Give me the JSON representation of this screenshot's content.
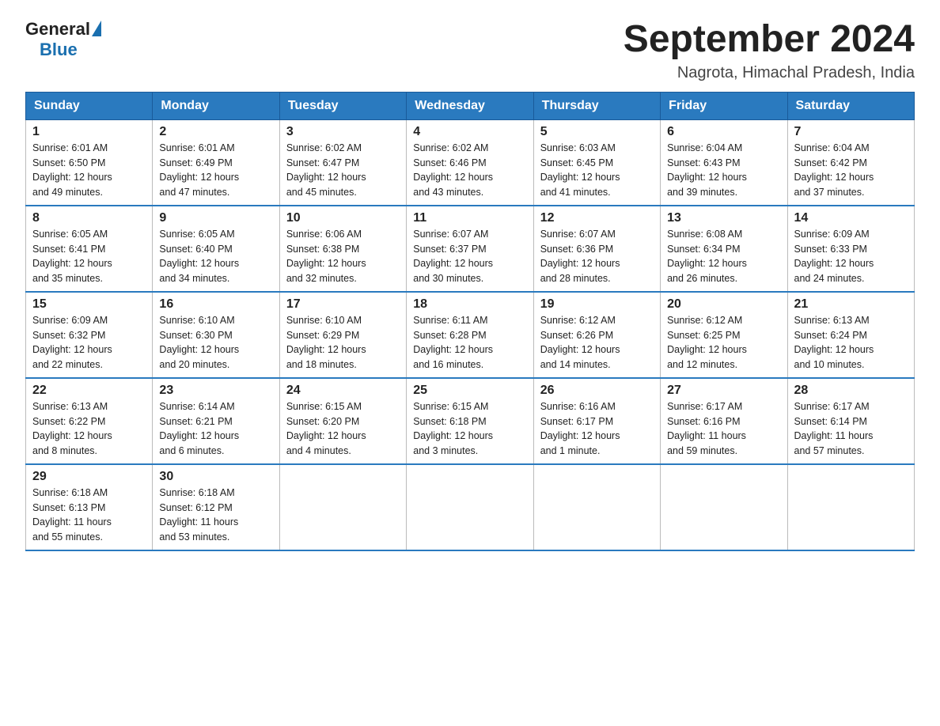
{
  "logo": {
    "general": "General",
    "blue": "Blue"
  },
  "title": "September 2024",
  "subtitle": "Nagrota, Himachal Pradesh, India",
  "days_of_week": [
    "Sunday",
    "Monday",
    "Tuesday",
    "Wednesday",
    "Thursday",
    "Friday",
    "Saturday"
  ],
  "weeks": [
    [
      {
        "day": "1",
        "sunrise": "6:01 AM",
        "sunset": "6:50 PM",
        "daylight": "12 hours and 49 minutes."
      },
      {
        "day": "2",
        "sunrise": "6:01 AM",
        "sunset": "6:49 PM",
        "daylight": "12 hours and 47 minutes."
      },
      {
        "day": "3",
        "sunrise": "6:02 AM",
        "sunset": "6:47 PM",
        "daylight": "12 hours and 45 minutes."
      },
      {
        "day": "4",
        "sunrise": "6:02 AM",
        "sunset": "6:46 PM",
        "daylight": "12 hours and 43 minutes."
      },
      {
        "day": "5",
        "sunrise": "6:03 AM",
        "sunset": "6:45 PM",
        "daylight": "12 hours and 41 minutes."
      },
      {
        "day": "6",
        "sunrise": "6:04 AM",
        "sunset": "6:43 PM",
        "daylight": "12 hours and 39 minutes."
      },
      {
        "day": "7",
        "sunrise": "6:04 AM",
        "sunset": "6:42 PM",
        "daylight": "12 hours and 37 minutes."
      }
    ],
    [
      {
        "day": "8",
        "sunrise": "6:05 AM",
        "sunset": "6:41 PM",
        "daylight": "12 hours and 35 minutes."
      },
      {
        "day": "9",
        "sunrise": "6:05 AM",
        "sunset": "6:40 PM",
        "daylight": "12 hours and 34 minutes."
      },
      {
        "day": "10",
        "sunrise": "6:06 AM",
        "sunset": "6:38 PM",
        "daylight": "12 hours and 32 minutes."
      },
      {
        "day": "11",
        "sunrise": "6:07 AM",
        "sunset": "6:37 PM",
        "daylight": "12 hours and 30 minutes."
      },
      {
        "day": "12",
        "sunrise": "6:07 AM",
        "sunset": "6:36 PM",
        "daylight": "12 hours and 28 minutes."
      },
      {
        "day": "13",
        "sunrise": "6:08 AM",
        "sunset": "6:34 PM",
        "daylight": "12 hours and 26 minutes."
      },
      {
        "day": "14",
        "sunrise": "6:09 AM",
        "sunset": "6:33 PM",
        "daylight": "12 hours and 24 minutes."
      }
    ],
    [
      {
        "day": "15",
        "sunrise": "6:09 AM",
        "sunset": "6:32 PM",
        "daylight": "12 hours and 22 minutes."
      },
      {
        "day": "16",
        "sunrise": "6:10 AM",
        "sunset": "6:30 PM",
        "daylight": "12 hours and 20 minutes."
      },
      {
        "day": "17",
        "sunrise": "6:10 AM",
        "sunset": "6:29 PM",
        "daylight": "12 hours and 18 minutes."
      },
      {
        "day": "18",
        "sunrise": "6:11 AM",
        "sunset": "6:28 PM",
        "daylight": "12 hours and 16 minutes."
      },
      {
        "day": "19",
        "sunrise": "6:12 AM",
        "sunset": "6:26 PM",
        "daylight": "12 hours and 14 minutes."
      },
      {
        "day": "20",
        "sunrise": "6:12 AM",
        "sunset": "6:25 PM",
        "daylight": "12 hours and 12 minutes."
      },
      {
        "day": "21",
        "sunrise": "6:13 AM",
        "sunset": "6:24 PM",
        "daylight": "12 hours and 10 minutes."
      }
    ],
    [
      {
        "day": "22",
        "sunrise": "6:13 AM",
        "sunset": "6:22 PM",
        "daylight": "12 hours and 8 minutes."
      },
      {
        "day": "23",
        "sunrise": "6:14 AM",
        "sunset": "6:21 PM",
        "daylight": "12 hours and 6 minutes."
      },
      {
        "day": "24",
        "sunrise": "6:15 AM",
        "sunset": "6:20 PM",
        "daylight": "12 hours and 4 minutes."
      },
      {
        "day": "25",
        "sunrise": "6:15 AM",
        "sunset": "6:18 PM",
        "daylight": "12 hours and 3 minutes."
      },
      {
        "day": "26",
        "sunrise": "6:16 AM",
        "sunset": "6:17 PM",
        "daylight": "12 hours and 1 minute."
      },
      {
        "day": "27",
        "sunrise": "6:17 AM",
        "sunset": "6:16 PM",
        "daylight": "11 hours and 59 minutes."
      },
      {
        "day": "28",
        "sunrise": "6:17 AM",
        "sunset": "6:14 PM",
        "daylight": "11 hours and 57 minutes."
      }
    ],
    [
      {
        "day": "29",
        "sunrise": "6:18 AM",
        "sunset": "6:13 PM",
        "daylight": "11 hours and 55 minutes."
      },
      {
        "day": "30",
        "sunrise": "6:18 AM",
        "sunset": "6:12 PM",
        "daylight": "11 hours and 53 minutes."
      },
      null,
      null,
      null,
      null,
      null
    ]
  ],
  "labels": {
    "sunrise": "Sunrise:",
    "sunset": "Sunset:",
    "daylight": "Daylight:"
  }
}
